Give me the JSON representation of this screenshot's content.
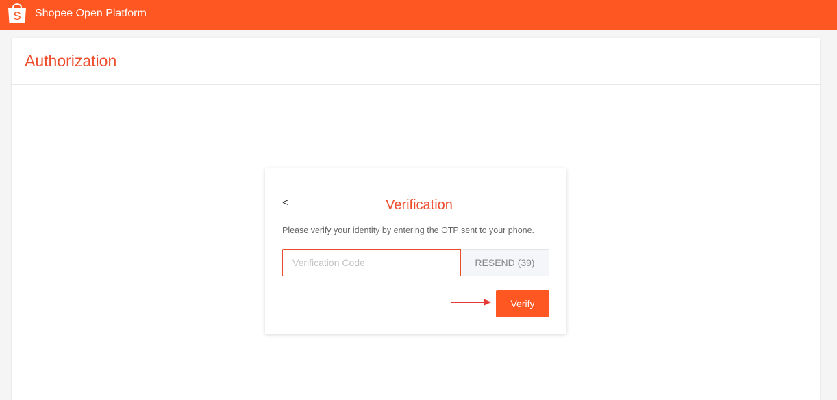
{
  "app": {
    "brand_name": "Shopee Open Platform",
    "logo_letter": "S",
    "logo_icon": "shopping-bag-icon"
  },
  "page": {
    "title": "Authorization"
  },
  "verification": {
    "back_label": "<",
    "title": "Verification",
    "instructions": "Please verify your identity by entering the OTP sent to your phone.",
    "code_value": "",
    "code_placeholder": "Verification Code",
    "resend_label": "RESEND (39)",
    "verify_label": "Verify"
  },
  "colors": {
    "brand_orange": "#ff5722",
    "title_orange": "#ee4d2d",
    "annotation_arrow": "#e53935"
  }
}
